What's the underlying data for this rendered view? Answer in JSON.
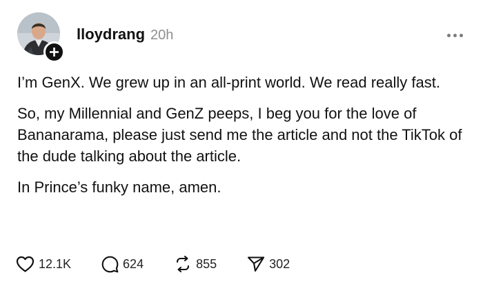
{
  "post": {
    "username": "lloydrang",
    "timestamp": "20h",
    "paragraphs": [
      "I’m GenX. We grew up in an all-print world. We read really fast.",
      "So, my Millennial and GenZ peeps, I beg you for the love of Bananarama, please just send me the article and not the TikTok of the dude talking about the article.",
      "In Prince’s funky name, amen."
    ]
  },
  "actions": {
    "likes": "12.1K",
    "replies": "624",
    "reposts": "855",
    "shares": "302"
  },
  "icons": {
    "avatar": "profile-photo",
    "follow": "plus-icon",
    "more": "ellipsis-icon",
    "like": "heart-icon",
    "reply": "speech-bubble-icon",
    "repost": "repost-icon",
    "share": "paper-plane-icon"
  }
}
